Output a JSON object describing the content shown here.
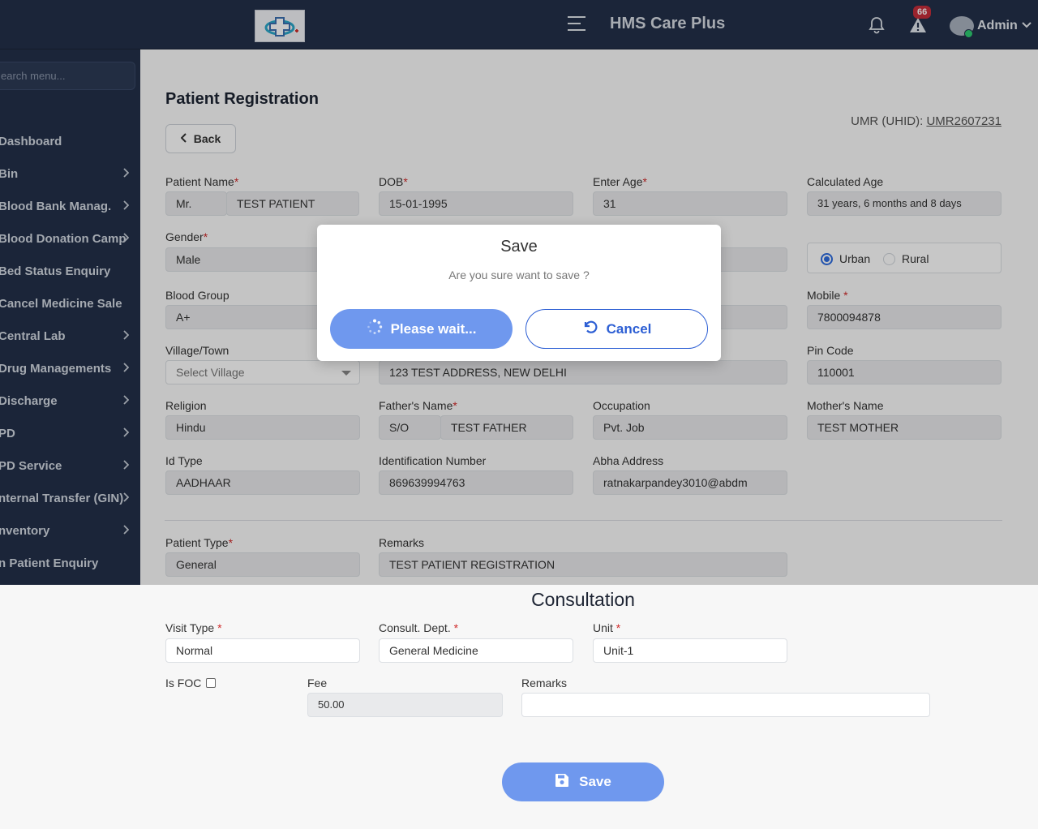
{
  "header": {
    "app_title": "HMS Care Plus",
    "notification_count": "66",
    "user_name": "Admin"
  },
  "sidebar": {
    "search_placeholder": "earch menu...",
    "items": [
      {
        "label": "Dashboard",
        "has_children": false
      },
      {
        "label": "Bin",
        "has_children": true
      },
      {
        "label": "Blood Bank Manag.",
        "has_children": true
      },
      {
        "label": "Blood Donation Camp",
        "has_children": true
      },
      {
        "label": "Bed Status Enquiry",
        "has_children": false
      },
      {
        "label": "Cancel Medicine Sale",
        "has_children": false
      },
      {
        "label": "Central Lab",
        "has_children": true
      },
      {
        "label": "Drug Managements",
        "has_children": true
      },
      {
        "label": "Discharge",
        "has_children": true
      },
      {
        "label": "PD",
        "has_children": true
      },
      {
        "label": "PD Service",
        "has_children": true
      },
      {
        "label": "nternal Transfer (GIN)",
        "has_children": true
      },
      {
        "label": "nventory",
        "has_children": true
      },
      {
        "label": "n Patient Enquiry",
        "has_children": false
      }
    ]
  },
  "page": {
    "title": "Patient Registration",
    "back_label": "Back",
    "umr_label": "UMR (UHID):",
    "umr_value": "UMR2607231"
  },
  "form": {
    "patient_name": {
      "label": "Patient Name",
      "prefix": "Mr.",
      "value": "TEST PATIENT"
    },
    "dob": {
      "label": "DOB",
      "value": "15-01-1995"
    },
    "age": {
      "label": "Enter Age",
      "value": "31"
    },
    "calc_age": {
      "label": "Calculated Age",
      "value": "31 years, 6 months and 8 days"
    },
    "gender": {
      "label": "Gender",
      "value": "Male"
    },
    "area": {
      "urban": "Urban",
      "rural": "Rural",
      "selected": "Urban"
    },
    "blood_group": {
      "label": "Blood Group",
      "value": "A+"
    },
    "mobile": {
      "label": "Mobile",
      "value": "7800094878"
    },
    "village": {
      "label": "Village/Town",
      "placeholder": "Select Village"
    },
    "address": {
      "value": "123 TEST ADDRESS, NEW DELHI"
    },
    "pin": {
      "label": "Pin Code",
      "value": "110001"
    },
    "religion": {
      "label": "Religion",
      "value": "Hindu"
    },
    "father": {
      "label": "Father's Name",
      "prefix": "S/O",
      "value": "TEST FATHER"
    },
    "occupation": {
      "label": "Occupation",
      "value": "Pvt. Job"
    },
    "mother": {
      "label": "Mother's Name",
      "value": "TEST MOTHER"
    },
    "id_type": {
      "label": "Id Type",
      "value": "AADHAAR"
    },
    "id_number": {
      "label": "Identification Number",
      "value": "869639994763"
    },
    "abha": {
      "label": "Abha Address",
      "value": "ratnakarpandey3010@abdm"
    },
    "patient_type": {
      "label": "Patient Type",
      "value": "General"
    },
    "remarks": {
      "label": "Remarks",
      "value": "TEST PATIENT REGISTRATION"
    }
  },
  "modal": {
    "title": "Save",
    "message": "Are you sure want to save ?",
    "wait_label": "Please wait...",
    "cancel_label": "Cancel"
  },
  "consultation": {
    "title": "Consultation",
    "visit_type": {
      "label": "Visit Type",
      "value": "Normal"
    },
    "dept": {
      "label": "Consult. Dept.",
      "value": "General Medicine"
    },
    "unit": {
      "label": "Unit",
      "value": "Unit-1"
    },
    "is_foc": {
      "label": "Is FOC",
      "checked": false
    },
    "fee": {
      "label": "Fee",
      "value": "50.00"
    },
    "remarks": {
      "label": "Remarks",
      "value": ""
    },
    "save_label": "Save"
  },
  "colors": {
    "navy": "#23304a",
    "primary_blue": "#2d5fd4",
    "button_blue": "#6f98ee",
    "required_red": "#d02a2a",
    "badge_red": "#c62d3a"
  }
}
